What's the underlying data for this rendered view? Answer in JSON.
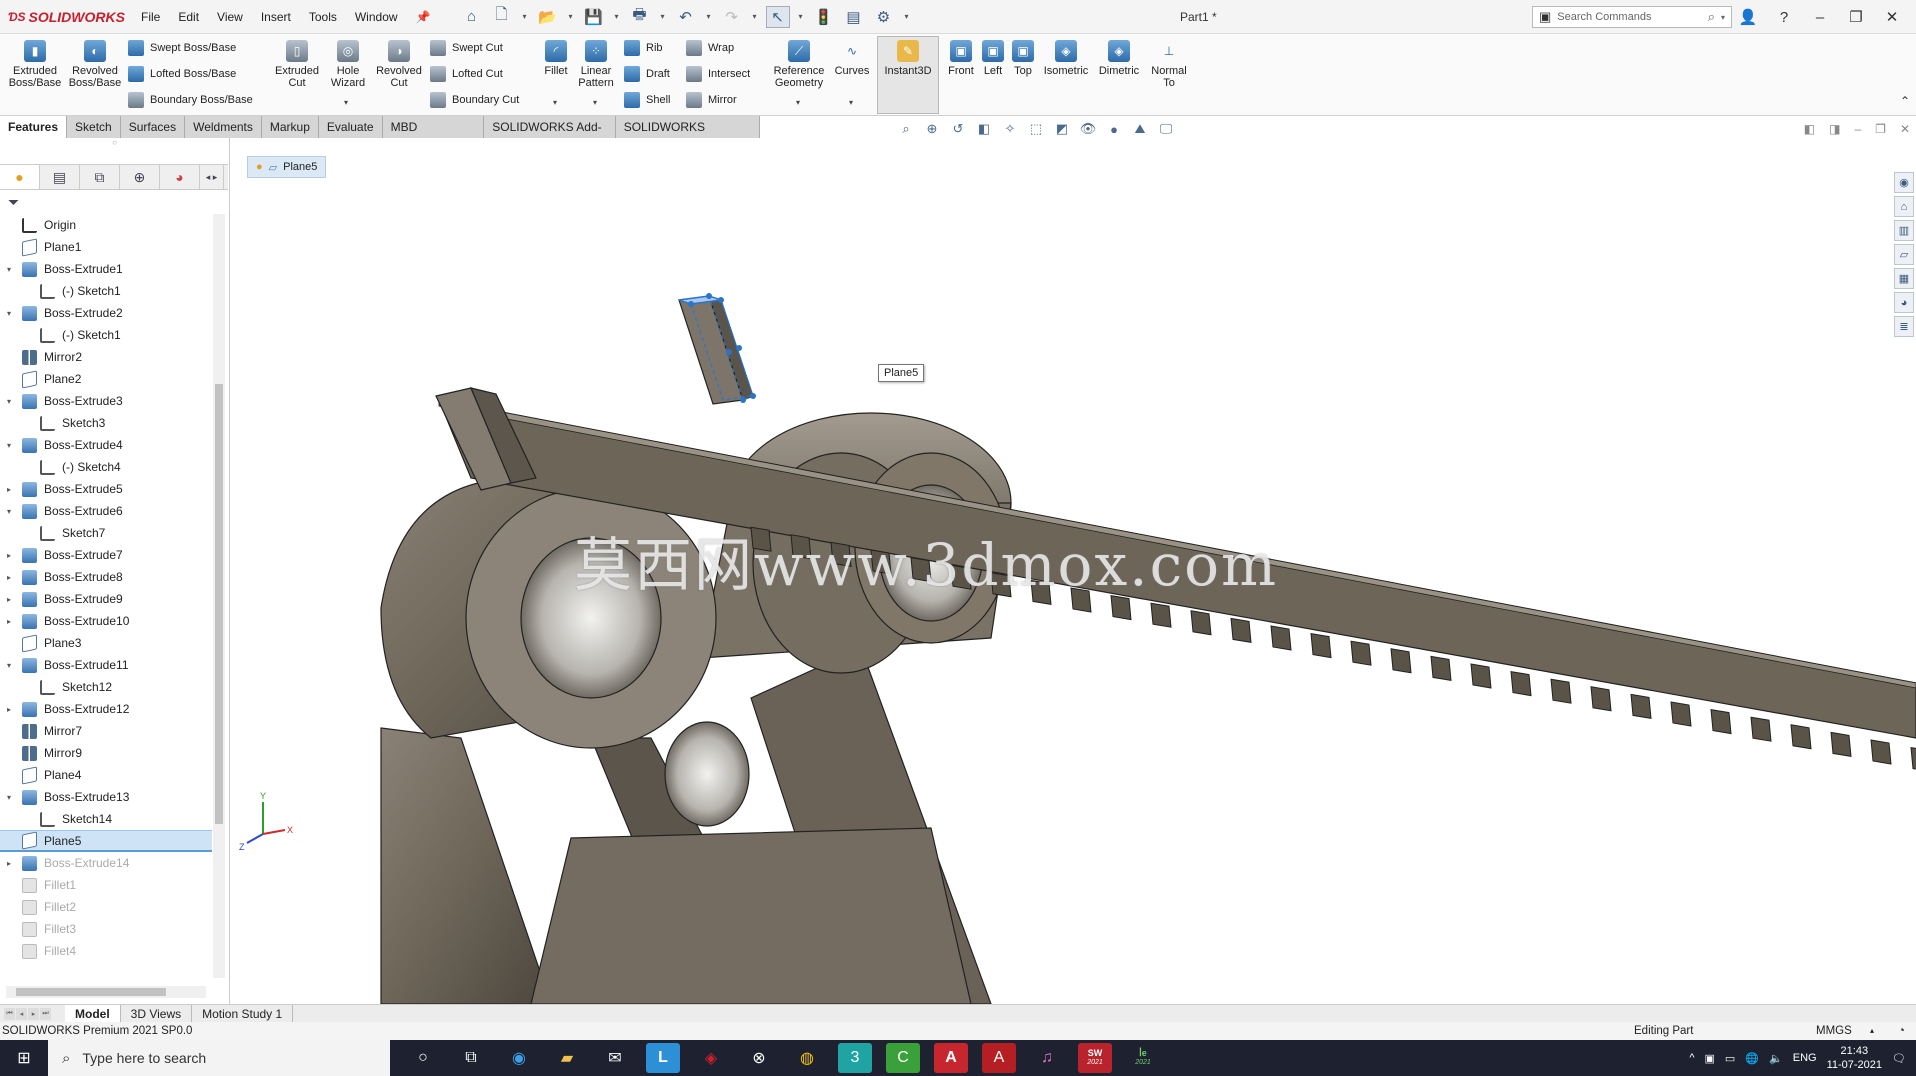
{
  "app": {
    "brand": "SOLIDWORKS",
    "document_title": "Part1 *",
    "menu": [
      "File",
      "Edit",
      "View",
      "Insert",
      "Tools",
      "Window"
    ],
    "search_placeholder": "Search Commands"
  },
  "ribbon": {
    "extruded_boss": "Extruded Boss/Base",
    "revolved_boss": "Revolved Boss/Base",
    "swept_boss": "Swept Boss/Base",
    "lofted_boss": "Lofted Boss/Base",
    "boundary_boss": "Boundary Boss/Base",
    "extruded_cut": "Extruded Cut",
    "hole_wizard": "Hole Wizard",
    "revolved_cut": "Revolved Cut",
    "swept_cut": "Swept Cut",
    "lofted_cut": "Lofted Cut",
    "boundary_cut": "Boundary Cut",
    "fillet": "Fillet",
    "linear_pattern": "Linear Pattern",
    "rib": "Rib",
    "draft": "Draft",
    "shell": "Shell",
    "wrap": "Wrap",
    "intersect": "Intersect",
    "mirror": "Mirror",
    "reference_geometry": "Reference Geometry",
    "curves": "Curves",
    "instant3d": "Instant3D",
    "front": "Front",
    "left": "Left",
    "top": "Top",
    "isometric": "Isometric",
    "dimetric": "Dimetric",
    "normal_to": "Normal To"
  },
  "command_tabs": [
    "Features",
    "Sketch",
    "Surfaces",
    "Weldments",
    "Markup",
    "Evaluate",
    "MBD Dimensions",
    "SOLIDWORKS Add-Ins",
    "SOLIDWORKS Inspection"
  ],
  "feature_tree": [
    {
      "label": "Origin",
      "type": "origin",
      "level": 0,
      "toggle": ""
    },
    {
      "label": "Plane1",
      "type": "plane",
      "level": 0,
      "toggle": ""
    },
    {
      "label": "Boss-Extrude1",
      "type": "feat",
      "level": 0,
      "toggle": "▾"
    },
    {
      "label": "(-) Sketch1",
      "type": "sketch",
      "level": 1,
      "toggle": ""
    },
    {
      "label": "Boss-Extrude2",
      "type": "feat",
      "level": 0,
      "toggle": "▾"
    },
    {
      "label": "(-) Sketch1",
      "type": "sketch",
      "level": 1,
      "toggle": ""
    },
    {
      "label": "Mirror2",
      "type": "mirror",
      "level": 0,
      "toggle": ""
    },
    {
      "label": "Plane2",
      "type": "plane",
      "level": 0,
      "toggle": ""
    },
    {
      "label": "Boss-Extrude3",
      "type": "feat",
      "level": 0,
      "toggle": "▾"
    },
    {
      "label": "Sketch3",
      "type": "sketch",
      "level": 1,
      "toggle": ""
    },
    {
      "label": "Boss-Extrude4",
      "type": "feat",
      "level": 0,
      "toggle": "▾"
    },
    {
      "label": "(-) Sketch4",
      "type": "sketch",
      "level": 1,
      "toggle": ""
    },
    {
      "label": "Boss-Extrude5",
      "type": "feat",
      "level": 0,
      "toggle": "▸"
    },
    {
      "label": "Boss-Extrude6",
      "type": "feat",
      "level": 0,
      "toggle": "▾"
    },
    {
      "label": "Sketch7",
      "type": "sketch",
      "level": 1,
      "toggle": ""
    },
    {
      "label": "Boss-Extrude7",
      "type": "feat",
      "level": 0,
      "toggle": "▸"
    },
    {
      "label": "Boss-Extrude8",
      "type": "feat",
      "level": 0,
      "toggle": "▸"
    },
    {
      "label": "Boss-Extrude9",
      "type": "feat",
      "level": 0,
      "toggle": "▸"
    },
    {
      "label": "Boss-Extrude10",
      "type": "feat",
      "level": 0,
      "toggle": "▸"
    },
    {
      "label": "Plane3",
      "type": "plane",
      "level": 0,
      "toggle": ""
    },
    {
      "label": "Boss-Extrude11",
      "type": "feat",
      "level": 0,
      "toggle": "▾"
    },
    {
      "label": "Sketch12",
      "type": "sketch",
      "level": 1,
      "toggle": ""
    },
    {
      "label": "Boss-Extrude12",
      "type": "feat",
      "level": 0,
      "toggle": "▸"
    },
    {
      "label": "Mirror7",
      "type": "mirror",
      "level": 0,
      "toggle": ""
    },
    {
      "label": "Mirror9",
      "type": "mirror",
      "level": 0,
      "toggle": ""
    },
    {
      "label": "Plane4",
      "type": "plane",
      "level": 0,
      "toggle": ""
    },
    {
      "label": "Boss-Extrude13",
      "type": "feat",
      "level": 0,
      "toggle": "▾"
    },
    {
      "label": "Sketch14",
      "type": "sketch",
      "level": 1,
      "toggle": ""
    },
    {
      "label": "Plane5",
      "type": "plane",
      "level": 0,
      "toggle": "",
      "selected": true
    },
    {
      "label": "Boss-Extrude14",
      "type": "feat",
      "level": 0,
      "toggle": "▸",
      "suppressed": true
    },
    {
      "label": "Fillet1",
      "type": "fillet",
      "level": 0,
      "toggle": "",
      "suppressed": true
    },
    {
      "label": "Fillet2",
      "type": "fillet",
      "level": 0,
      "toggle": "",
      "suppressed": true
    },
    {
      "label": "Fillet3",
      "type": "fillet",
      "level": 0,
      "toggle": "",
      "suppressed": true
    },
    {
      "label": "Fillet4",
      "type": "fillet",
      "level": 0,
      "toggle": "",
      "suppressed": true
    }
  ],
  "viewport": {
    "breadcrumb": "Plane5",
    "tooltip": "Plane5",
    "watermark": "莫西网www.3dmox.com",
    "triad": {
      "x": "X",
      "y": "Y",
      "z": "Z"
    }
  },
  "bottom_tabs": [
    "Model",
    "3D Views",
    "Motion Study 1"
  ],
  "status": {
    "product": "SOLIDWORKS Premium 2021 SP0.0",
    "mode": "Editing Part",
    "units": "MMGS"
  },
  "taskbar": {
    "search_placeholder": "Type here to search",
    "language": "ENG",
    "time": "21:43",
    "date": "11-07-2021",
    "sw_badge": "2021",
    "ie_badge": "2021"
  }
}
